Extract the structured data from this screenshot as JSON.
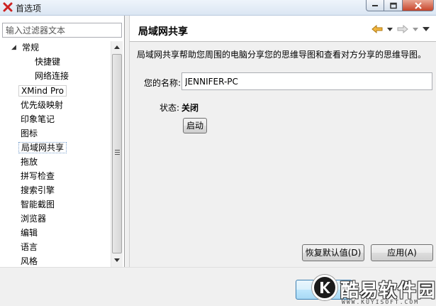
{
  "window": {
    "title": "首选项"
  },
  "filter": {
    "placeholder": "输入过滤器文本"
  },
  "tree": {
    "items": [
      {
        "label": "常规"
      },
      {
        "label": "快捷键"
      },
      {
        "label": "网络连接"
      },
      {
        "label": "XMind Pro"
      },
      {
        "label": "优先级映射"
      },
      {
        "label": "印象笔记"
      },
      {
        "label": "图标"
      },
      {
        "label": "局域网共享"
      },
      {
        "label": "拖放"
      },
      {
        "label": "拼写检查"
      },
      {
        "label": "搜索引擎"
      },
      {
        "label": "智能截图"
      },
      {
        "label": "浏览器"
      },
      {
        "label": "编辑"
      },
      {
        "label": "语言"
      },
      {
        "label": "风格"
      }
    ],
    "selected": "局域网共享",
    "expand_glyph": "◢"
  },
  "page": {
    "title": "局域网共享",
    "description": "局域网共享帮助您周围的电脑分享您的思维导图和查看对方分享的思维导图。",
    "name_label": "您的名称:",
    "name_value": "JENNIFER-PC",
    "status_label": "状态:",
    "status_value": "关闭",
    "start_button": "启动",
    "restore_button": "恢复默认值(D)",
    "apply_button": "应用(A)"
  },
  "watermark": {
    "text": "酷易软件园",
    "url": "WWW.KUYISOFT.COM"
  },
  "colors": {
    "nav_back": "#e0a020",
    "nav_forward": "#a8a8a8",
    "app_icon": "#cc2222"
  }
}
